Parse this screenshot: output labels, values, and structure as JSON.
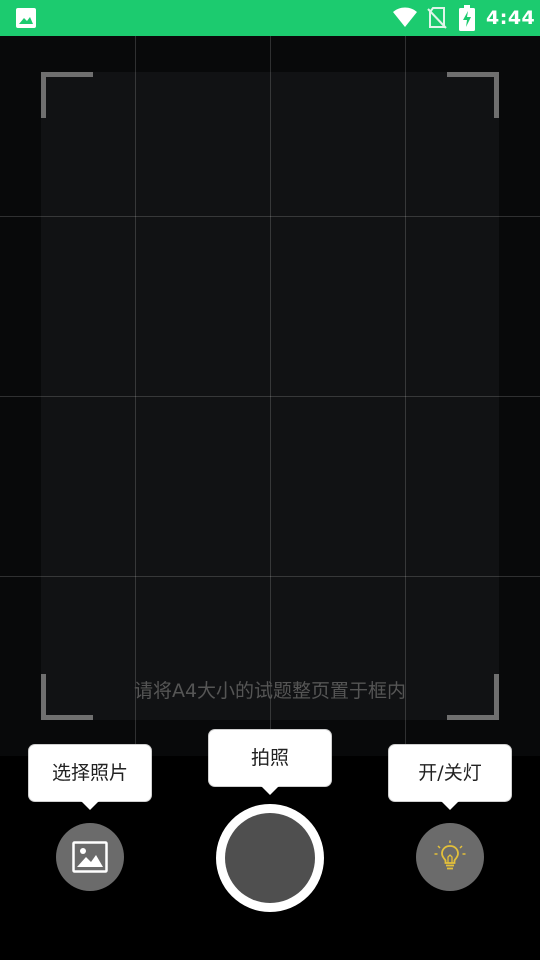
{
  "status_bar": {
    "time": "4:44",
    "icons": [
      "gallery-icon",
      "wifi-icon",
      "no-sim-icon",
      "battery-charging-icon"
    ],
    "background_color": "#1ccb6f"
  },
  "viewfinder": {
    "hint": "请将A4大小的试题整页置于框内"
  },
  "controls": {
    "choose_photo_tooltip": "选择照片",
    "capture_tooltip": "拍照",
    "light_tooltip": "开/关灯",
    "choose_photo_icon": "image-icon",
    "light_icon": "lightbulb-icon"
  },
  "colors": {
    "accent_bulb": "#e3c03a",
    "button_gray": "#6b6b6b",
    "shutter_inner": "#4f4f4f"
  }
}
